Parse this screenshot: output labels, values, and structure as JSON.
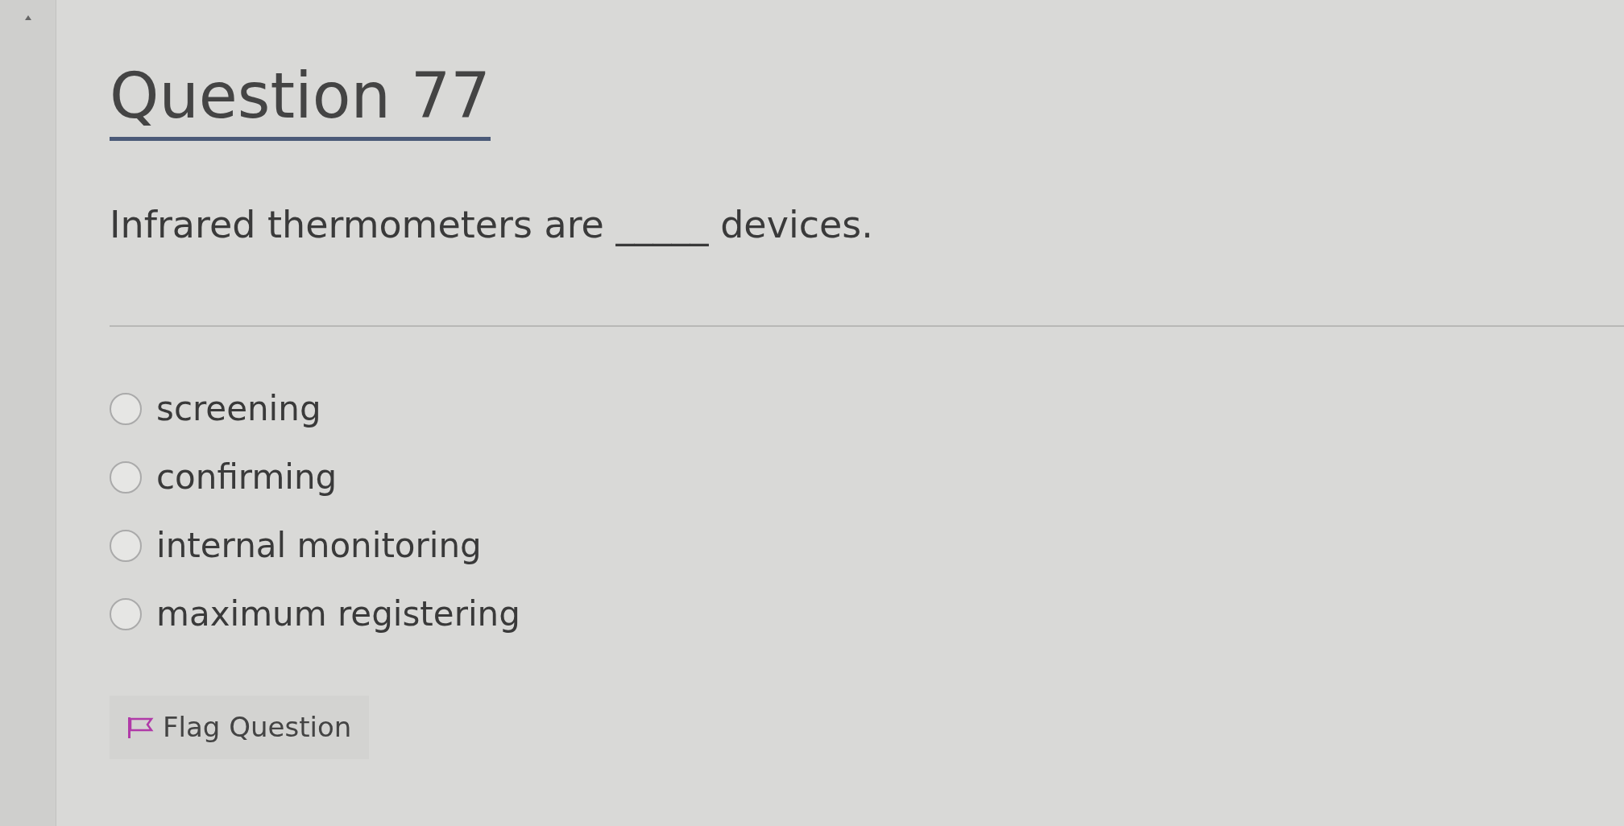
{
  "title": "Question 77",
  "question": "Infrared thermometers are _____ devices.",
  "options": [
    {
      "label": "screening",
      "selected": false
    },
    {
      "label": "confirming",
      "selected": false
    },
    {
      "label": "internal monitoring",
      "selected": false
    },
    {
      "label": "maximum registering",
      "selected": false
    }
  ],
  "flag_button": "Flag Question"
}
